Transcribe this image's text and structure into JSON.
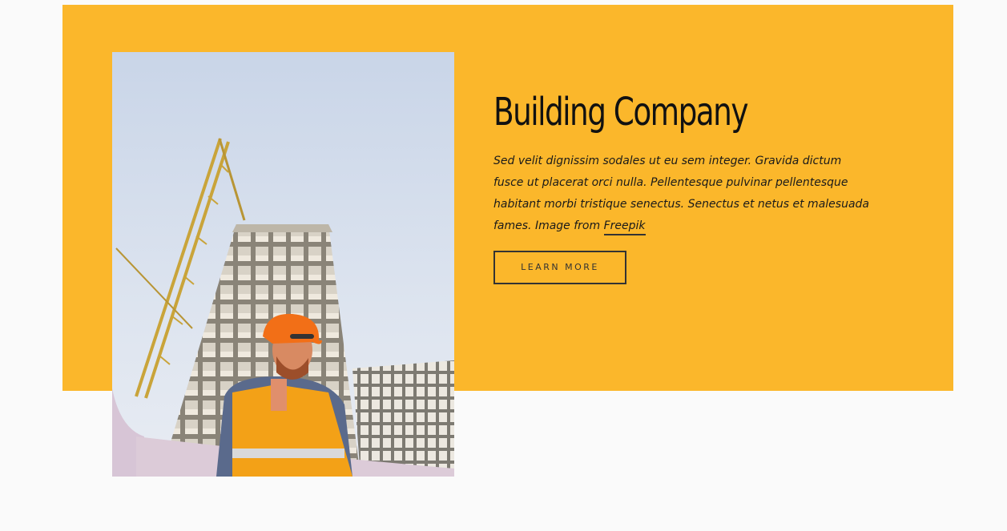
{
  "hero": {
    "title": "Building Company",
    "description": "Sed velit dignissim sodales ut eu sem integer. Gravida dictum fusce ut placerat orci nulla. Pellentesque pulvinar pellentesque habitant morbi tristique senectus. Senectus et netus et malesuada fames. Image from ",
    "link_label": "Freepik",
    "button_label": "LEARN MORE",
    "image_alt": "Construction worker in orange hard hat and safety vest in front of a high-rise building under construction with a crane"
  },
  "colors": {
    "accent": "#fbb72b",
    "background": "#fafafa",
    "text": "#111111"
  }
}
